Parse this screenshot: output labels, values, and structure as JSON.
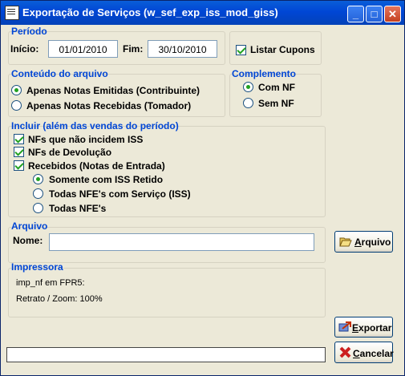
{
  "window": {
    "title": "Exportação de Serviços (w_sef_exp_iss_mod_giss)"
  },
  "periodo": {
    "title": "Período",
    "inicio_label": "Início:",
    "inicio_value": "01/01/2010",
    "fim_label": "Fim:",
    "fim_value": "30/10/2010"
  },
  "listar_cupons": {
    "label": "Listar Cupons",
    "checked": true
  },
  "conteudo": {
    "title": "Conteúdo do arquivo",
    "options": [
      "Apenas Notas Emitidas (Contribuinte)",
      "Apenas Notas Recebidas (Tomador)"
    ],
    "selected": 0
  },
  "complemento": {
    "title": "Complemento",
    "options": [
      "Com NF",
      "Sem NF"
    ],
    "selected": 0
  },
  "incluir": {
    "title": "Incluir (além das vendas do período)",
    "checks": [
      "NFs que não incidem ISS",
      "NFs de Devolução",
      "Recebidos (Notas de Entrada)"
    ],
    "radios": [
      "Somente com ISS Retido",
      "Todas NFE's com Serviço (ISS)",
      "Todas NFE's"
    ],
    "selected": 0
  },
  "arquivo": {
    "title": "Arquivo",
    "nome_label": "Nome:",
    "nome_value": "",
    "button_first": "A",
    "button_rest": "rquivo"
  },
  "impressora": {
    "title": "Impressora",
    "line1": "imp_nf em FPR5:",
    "line2": "Retrato / Zoom: 100%"
  },
  "actions": {
    "exportar_first": "E",
    "exportar_rest": "xportar",
    "cancelar_first": "C",
    "cancelar_rest": "ancelar"
  },
  "status": {
    "text": ""
  },
  "colors": {
    "title_blue": "#0046d5",
    "check_green": "#21a121",
    "face": "#ece9d8"
  }
}
